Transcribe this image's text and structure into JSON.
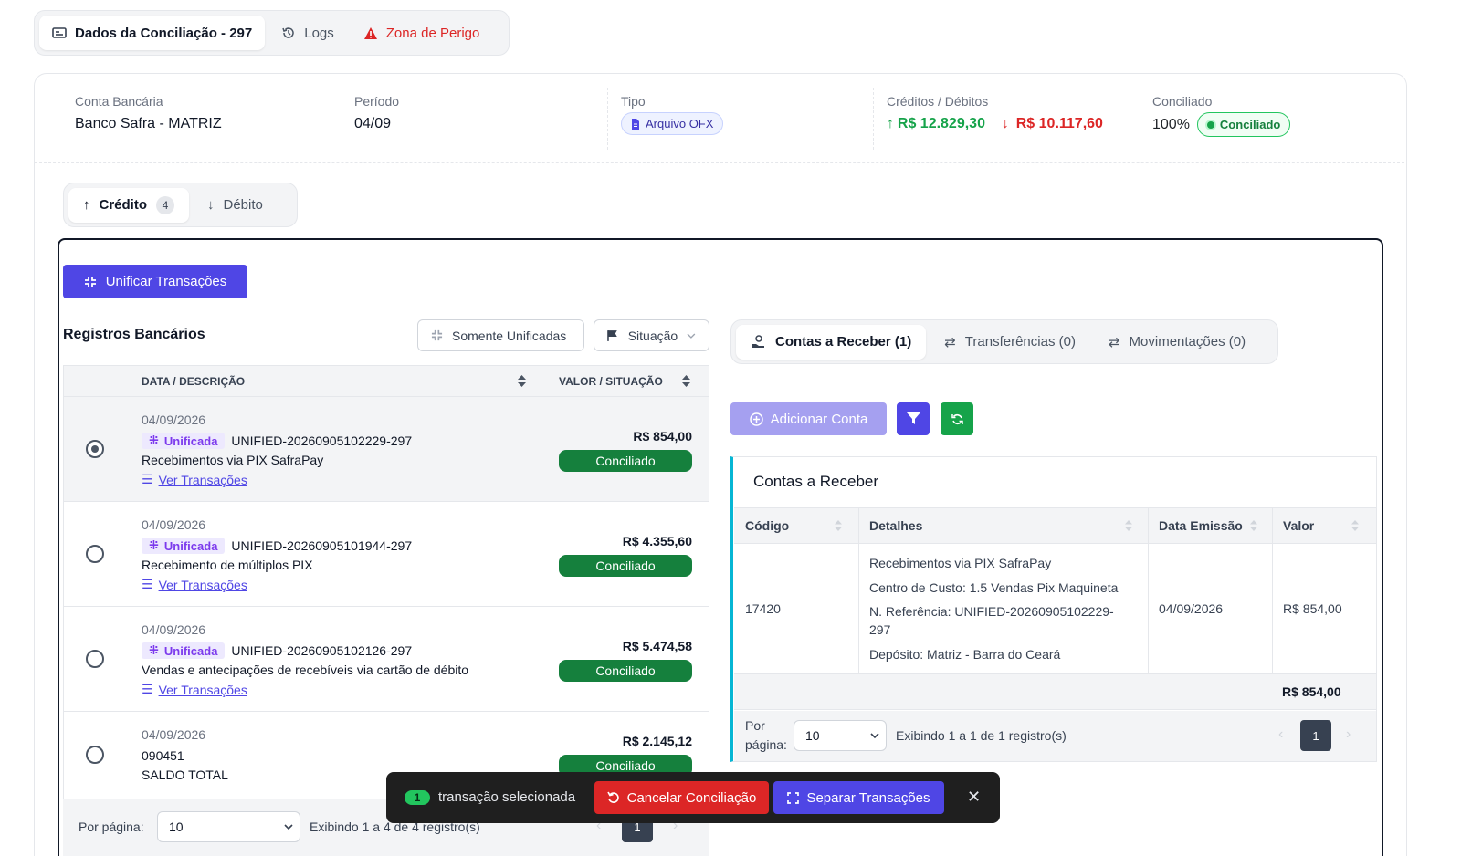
{
  "top_tabs": {
    "dados": "Dados da Conciliação - 297",
    "logs": "Logs",
    "perigo": "Zona de Perigo"
  },
  "summary": {
    "conta_label": "Conta Bancária",
    "conta_value": "Banco Safra - MATRIZ",
    "periodo_label": "Período",
    "periodo_value": "04/09",
    "tipo_label": "Tipo",
    "tipo_value": "Arquivo OFX",
    "cd_label": "Créditos / Débitos",
    "credito_value": "R$ 12.829,30",
    "debito_value": "R$ 10.117,60",
    "conciliado_label": "Conciliado",
    "conciliado_pct": "100%",
    "conciliado_badge": "Conciliado"
  },
  "cd_tabs": {
    "credito": "Crédito",
    "credito_count": "4",
    "debito": "Débito"
  },
  "actions": {
    "unificar": "Unificar Transações"
  },
  "registros": {
    "title": "Registros Bancários",
    "filter_unificadas": "Somente Unificadas",
    "filter_situacao": "Situação",
    "col_data": "DATA / DESCRIÇÃO",
    "col_valor": "VALOR / SITUAÇÃO",
    "unificada_label": "Unificada",
    "ver_label": "Ver Transações",
    "status_label": "Conciliado",
    "rows": [
      {
        "date": "04/09/2026",
        "code": "UNIFIED-20260905102229-297",
        "desc": "Recebimentos via PIX SafraPay",
        "amount": "R$ 854,00"
      },
      {
        "date": "04/09/2026",
        "code": "UNIFIED-20260905101944-297",
        "desc": "Recebimento de múltiplos PIX",
        "amount": "R$ 4.355,60"
      },
      {
        "date": "04/09/2026",
        "code": "UNIFIED-20260905102126-297",
        "desc": "Vendas e antecipações de recebíveis via cartão de débito",
        "amount": "R$ 5.474,58"
      },
      {
        "date": "04/09/2026",
        "code": "090451",
        "desc": "SALDO TOTAL",
        "amount": "R$ 2.145,12"
      }
    ],
    "pagination": {
      "per_page_label": "Por página:",
      "per_page_value": "10",
      "info": "Exibindo 1 a 4 de 4 registro(s)",
      "page": "1"
    }
  },
  "right_tabs": {
    "receber": "Contas a Receber (1)",
    "transferencias": "Transferências (0)",
    "movimentacoes": "Movimentações (0)"
  },
  "right_actions": {
    "adicionar": "Adicionar Conta"
  },
  "contas": {
    "title": "Contas a Receber",
    "col_codigo": "Código",
    "col_detalhes": "Detalhes",
    "col_data": "Data Emissão",
    "col_valor": "Valor",
    "row": {
      "codigo": "17420",
      "det1": "Recebimentos via PIX SafraPay",
      "det2": "Centro de Custo: 1.5 Vendas Pix Maquineta",
      "det3a": "N. Referência: UNIFIED-20260905102229-",
      "det3b": "297",
      "det4": "Depósito: Matriz - Barra do Ceará",
      "data": "04/09/2026",
      "valor": "R$ 854,00"
    },
    "total": "R$ 854,00",
    "pagination": {
      "per_page_label_1": "Por",
      "per_page_label_2": "página:",
      "per_page_value": "10",
      "info": "Exibindo 1 a 1 de 1 registro(s)",
      "page": "1"
    }
  },
  "selection_bar": {
    "count": "1",
    "text": "transação selecionada",
    "cancel": "Cancelar Conciliação",
    "separar": "Separar Transações"
  }
}
